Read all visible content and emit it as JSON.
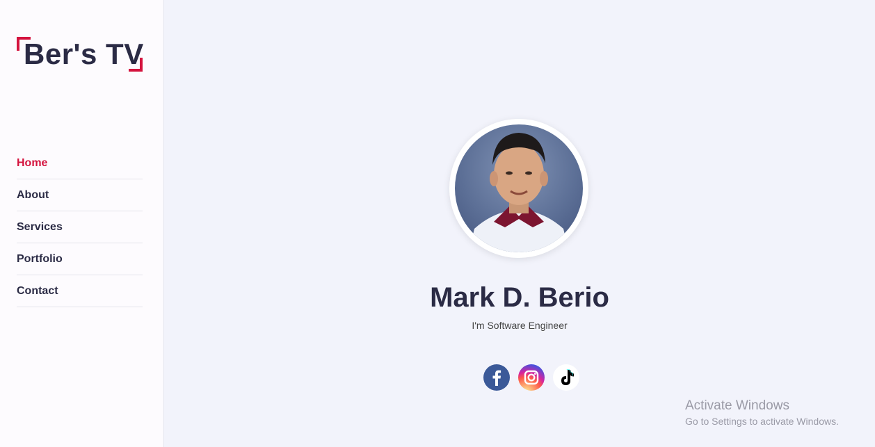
{
  "sidebar": {
    "logo_text": "Ber's TV",
    "nav": [
      {
        "label": "Home",
        "active": true
      },
      {
        "label": "About",
        "active": false
      },
      {
        "label": "Services",
        "active": false
      },
      {
        "label": "Portfolio",
        "active": false
      },
      {
        "label": "Contact",
        "active": false
      }
    ]
  },
  "profile": {
    "name": "Mark D. Berio",
    "role": "I'm Software Engineer"
  },
  "socials": [
    {
      "icon": "facebook-icon"
    },
    {
      "icon": "instagram-icon"
    },
    {
      "icon": "tiktok-icon"
    }
  ],
  "watermark": {
    "title": "Activate Windows",
    "subtitle": "Go to Settings to activate Windows."
  },
  "colors": {
    "accent": "#d4133e",
    "text": "#2b2b45",
    "background": "#f2f3fb"
  }
}
